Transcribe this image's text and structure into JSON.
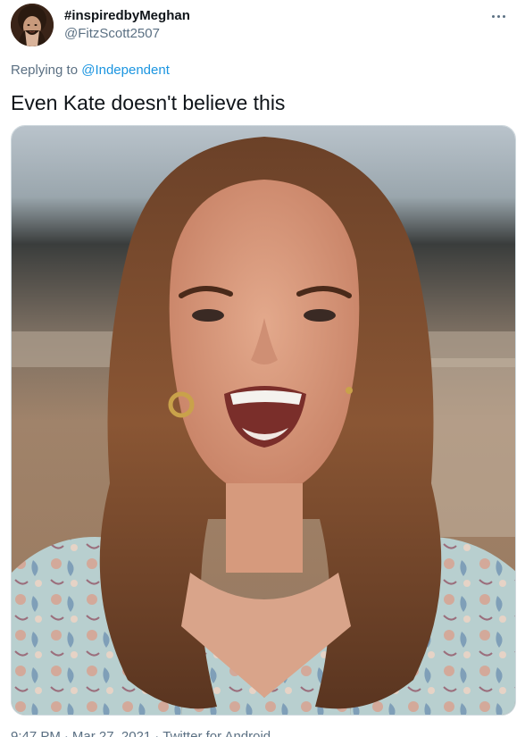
{
  "user": {
    "display_name": "#inspiredbyMeghan",
    "handle": "@FitzScott2507"
  },
  "reply": {
    "prefix": "Replying to",
    "mention": "@Independent"
  },
  "tweet": {
    "text": "Even Kate doesn't believe this"
  },
  "meta": {
    "time": "9:47 PM",
    "date": "Mar 27, 2021",
    "source": "Twitter for Android"
  },
  "icons": {
    "more": "more-options-icon"
  },
  "colors": {
    "text": "#0f1419",
    "secondary": "#5b7083",
    "link": "#1b95e0",
    "border": "#cfd9de"
  }
}
